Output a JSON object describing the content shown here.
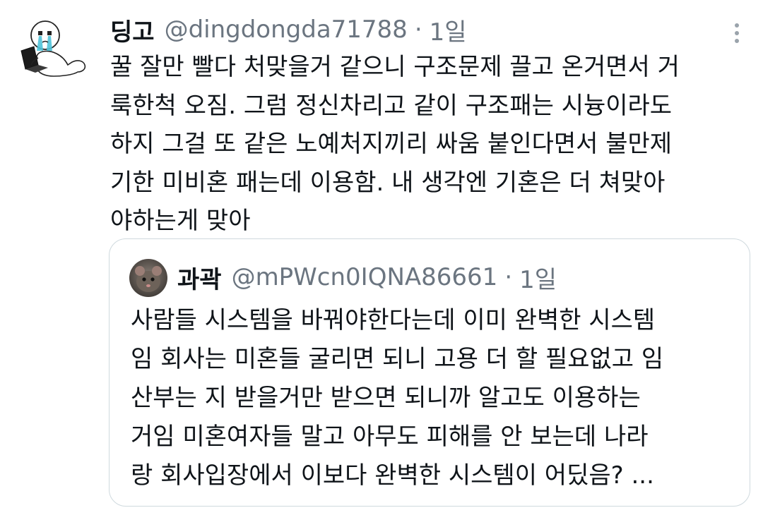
{
  "tweet": {
    "display_name": "딩고",
    "handle": "@dingdongda71788",
    "separator": "·",
    "time": "1일",
    "more_icon": "more-vertical-icon",
    "avatar_icon": "crying-cartoon-avatar",
    "body_lines": [
      "꿀 잘만 빨다 처맞을거 같으니 구조문제 끌고 온거면서 거",
      "룩한척 오짐. 그럼 정신차리고 같이 구조패는 시늉이라도",
      "하지 그걸 또 같은 노예처지끼리 싸움 붙인다면서 불만제",
      "기한 미비혼 패는데 이용함. 내 생각엔 기혼은 더 쳐맞아",
      "야하는게 맞아"
    ]
  },
  "quoted_tweet": {
    "display_name": "과곽",
    "handle": "@mPWcn0IQNA86661",
    "separator": "·",
    "time": "1일",
    "avatar_icon": "rat-photo-avatar",
    "body_lines": [
      "사람들 시스템을 바꿔야한다는데 이미 완벽한 시스템",
      "임 회사는 미혼들 굴리면 되니 고용 더 할 필요없고 임",
      "산부는 지 받을거만 받으면 되니까 알고도 이용하는",
      "거임 미혼여자들 말고 아무도 피해를 안 보는데 나라",
      "랑 회사입장에서 이보다 완벽한 시스템이 어딨음? ..."
    ]
  },
  "colors": {
    "text": "#0f1419",
    "secondary": "#6b7580",
    "border": "#cfd9de",
    "background": "#ffffff"
  }
}
